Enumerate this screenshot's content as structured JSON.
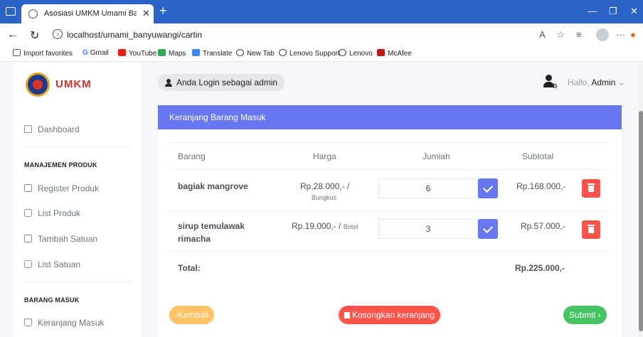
{
  "browser": {
    "tab_title": "Asosiasi UMKM Umami Banyuwangi",
    "url": "localhost/umami_banyuwangi/cartin",
    "bookmarks": [
      "Import favorites",
      "Gmail",
      "YouTube",
      "Maps",
      "Translate",
      "New Tab",
      "Lenovo Support",
      "Lenovo",
      "McAfee"
    ]
  },
  "sidebar": {
    "brand": "UMKM",
    "dashboard": "Dashboard",
    "section_produk": "MANAJEMEN PRODUK",
    "register_produk": "Register Produk",
    "list_produk": "List Produk",
    "tambah_satuan": "Tambah Satuan",
    "list_satuan": "List Satuan",
    "section_barang": "BARANG MASUK",
    "keranjang_masuk": "Keranjang Masuk"
  },
  "topbar": {
    "login_status": "Anda Login sebagai admin",
    "greeting": "Hallo,",
    "user": "Admin"
  },
  "card": {
    "title": "Keranjang Barang Masuk",
    "headers": [
      "Barang",
      "Harga",
      "Jumlah",
      "Subtotal"
    ],
    "rows": [
      {
        "name": "bagiak mangrove",
        "price": "Rp.28.000,- /",
        "unit": "Bungkus",
        "qty": "6",
        "subtotal": "Rp.168.000,-"
      },
      {
        "name_1": "sirup temulawak",
        "name_2": "rimacha",
        "price": "Rp.19.000,- /",
        "unit": "Botol",
        "qty": "3",
        "subtotal": "Rp.57.000,-"
      }
    ],
    "total_label": "Total:",
    "total_value": "Rp.225.000,-",
    "back_label": "Kembali",
    "clear_label": "Kosongkan keranjang",
    "submit_label": "Submit"
  }
}
